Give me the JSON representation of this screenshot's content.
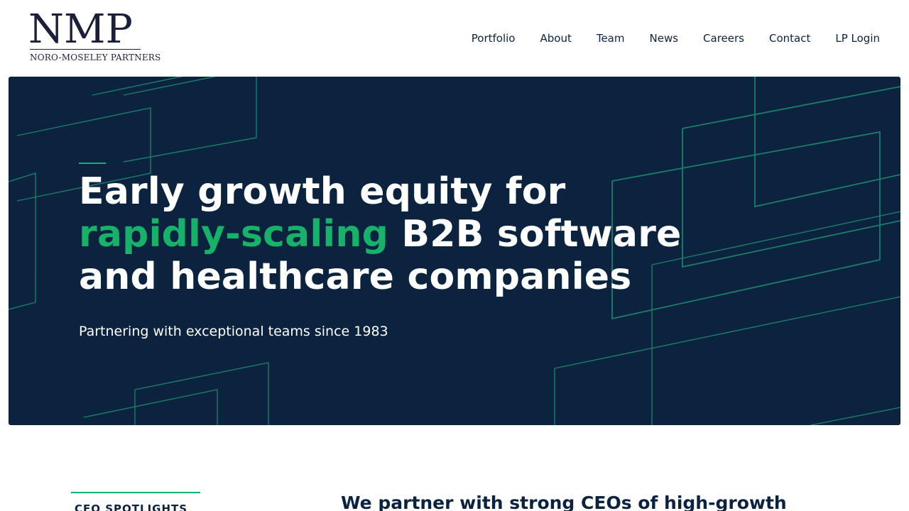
{
  "brand": {
    "mark": "NMP",
    "name": "NORO-MOSELEY PARTNERS"
  },
  "nav": {
    "items": [
      "Portfolio",
      "About",
      "Team",
      "News",
      "Careers",
      "Contact",
      "LP Login"
    ]
  },
  "hero": {
    "title_line1": "Early growth equity for",
    "title_highlight": "rapidly-scaling",
    "title_rest2": " B2B software",
    "title_line3": "and healthcare companies",
    "subtitle": "Partnering with exceptional teams since 1983"
  },
  "section": {
    "spotlight_label": "CEO SPOTLIGHTS",
    "intro_heading": "We partner with strong CEOs of high-growth"
  },
  "colors": {
    "navy": "#0c2340",
    "accent_green": "#17b26a",
    "line_green": "#1f8a6a"
  }
}
